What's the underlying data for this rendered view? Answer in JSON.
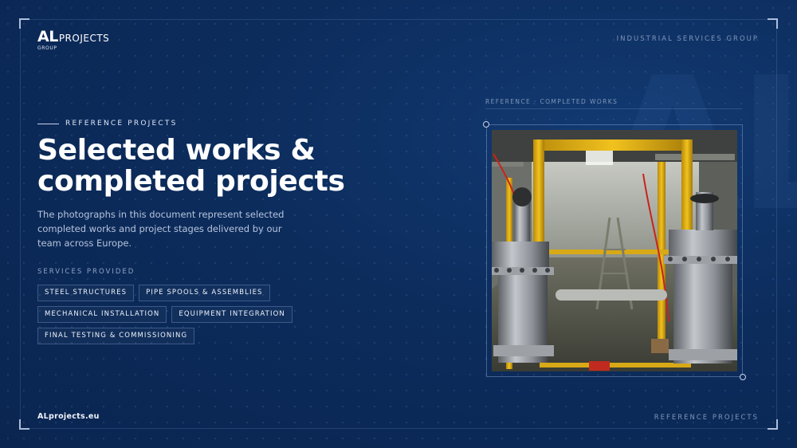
{
  "brand": {
    "logo_al": "AL",
    "logo_projects": "PROJECTS",
    "logo_group": "GROUP",
    "watermark": "AL",
    "tagline": "INDUSTRIAL SERVICES GROUP"
  },
  "hero": {
    "eyebrow": "REFERENCE PROJECTS",
    "title_line1": "Selected works &",
    "title_line2": "completed projects",
    "description": "The photographs in this document represent selected completed works and project stages delivered by our team across Europe."
  },
  "services": {
    "label": "SERVICES PROVIDED",
    "items": [
      "STEEL STRUCTURES",
      "PIPE SPOOLS & ASSEMBLIES",
      "MECHANICAL INSTALLATION",
      "EQUIPMENT INTEGRATION",
      "FINAL TESTING & COMMISSIONING"
    ]
  },
  "photo": {
    "caption": "REFERENCE · COMPLETED WORKS",
    "subject": "industrial-gas-filter-station-photo"
  },
  "footer": {
    "website": "ALprojects.eu",
    "section": "REFERENCE PROJECTS"
  },
  "colors": {
    "background": "#0c2c5c",
    "accent_pipe": "#e8b418",
    "muted_text": "#7f95b8"
  }
}
